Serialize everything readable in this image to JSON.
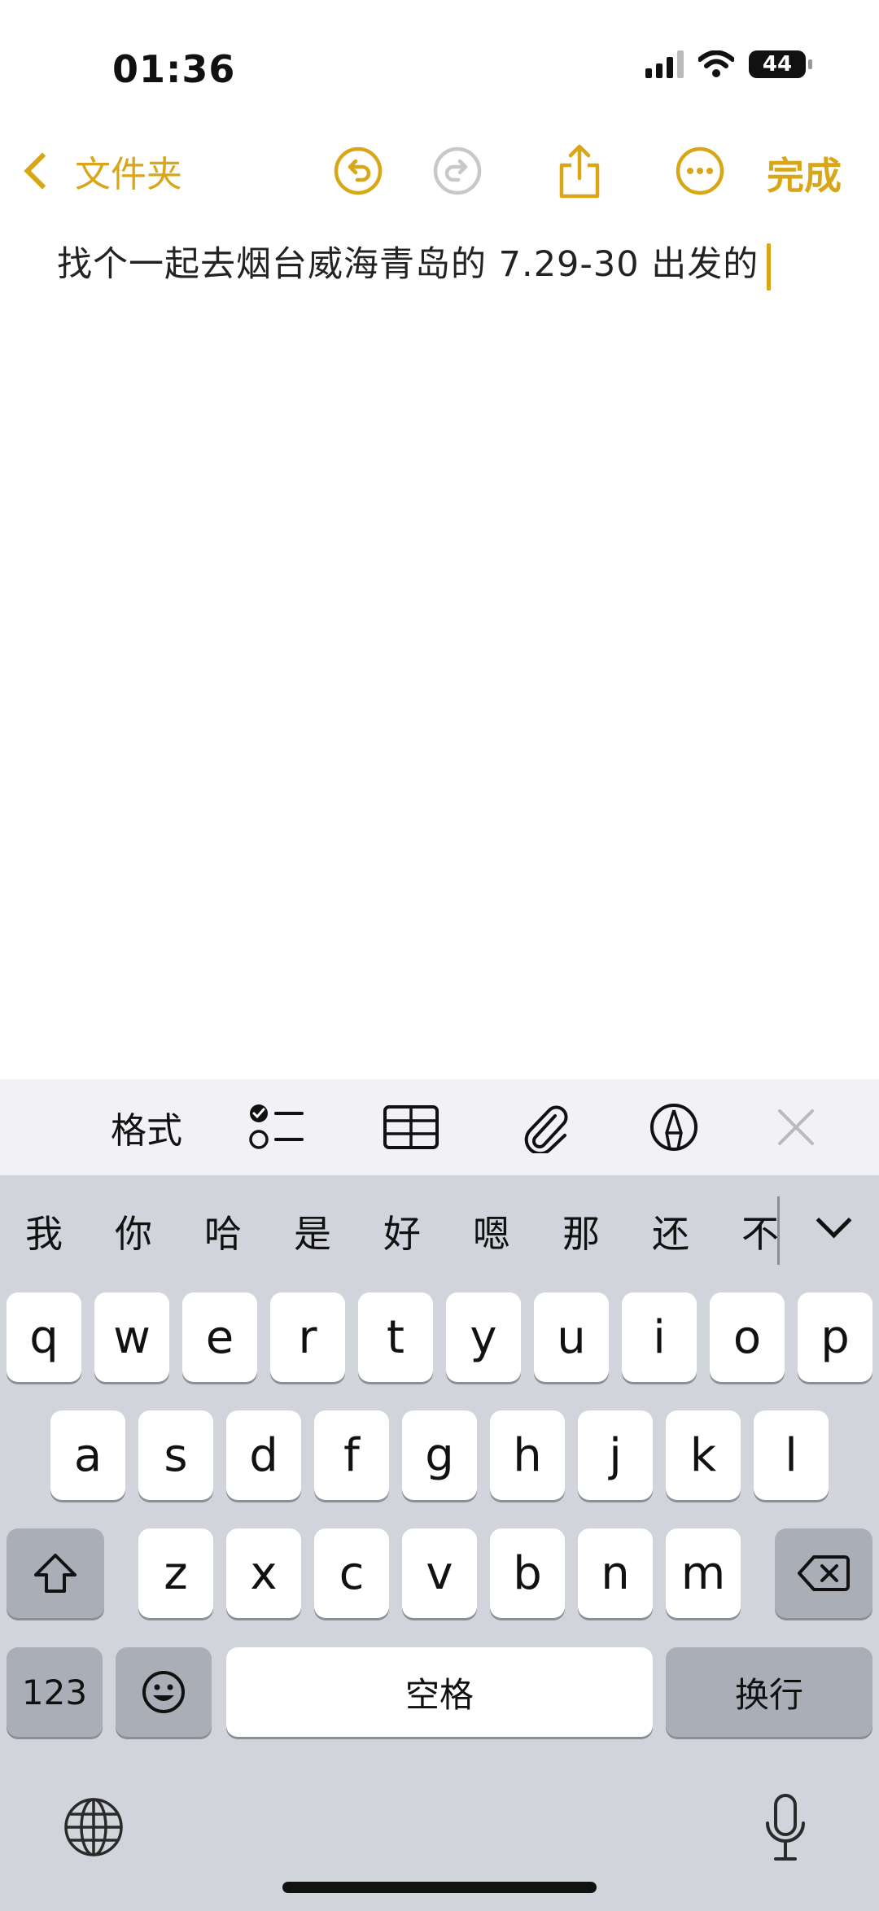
{
  "status_bar": {
    "time": "01:36",
    "battery": "44"
  },
  "nav": {
    "back_label": "文件夹",
    "done_label": "完成"
  },
  "note": {
    "text": "找个一起去烟台威海青岛的  7.29-30 出发的"
  },
  "toolbar": {
    "format_label": "格式"
  },
  "candidates": [
    "我",
    "你",
    "哈",
    "是",
    "好",
    "嗯",
    "那",
    "还",
    "不"
  ],
  "keyboard": {
    "row1": [
      "q",
      "w",
      "e",
      "r",
      "t",
      "y",
      "u",
      "i",
      "o",
      "p"
    ],
    "row2": [
      "a",
      "s",
      "d",
      "f",
      "g",
      "h",
      "j",
      "k",
      "l"
    ],
    "row3": [
      "z",
      "x",
      "c",
      "v",
      "b",
      "n",
      "m"
    ],
    "numbers_label": "123",
    "space_label": "空格",
    "return_label": "换行"
  },
  "colors": {
    "accent": "#d8a617",
    "keyboard_bg": "#d1d4da",
    "toolbar_bg": "#f2f2f6"
  }
}
